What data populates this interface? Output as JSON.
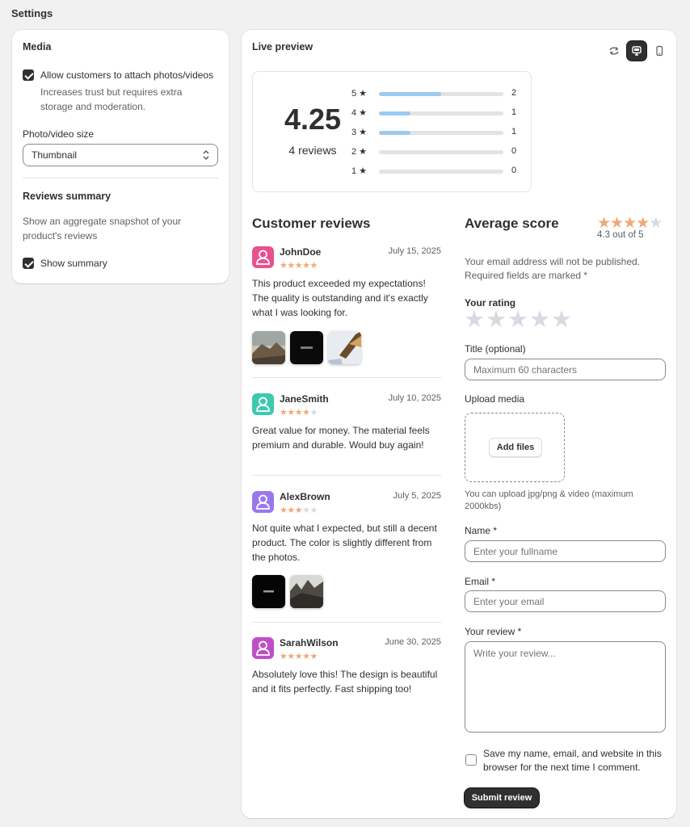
{
  "page": {
    "title": "Settings"
  },
  "settings": {
    "media": {
      "title": "Media",
      "allow_label": "Allow customers to attach photos/videos",
      "allow_checked": true,
      "allow_help_1": "Increases trust but requires extra",
      "allow_help_2": "storage and moderation.",
      "size_label": "Photo/video size",
      "size_value": "Thumbnail"
    },
    "summary": {
      "title": "Reviews summary",
      "desc_1": "Show an aggregate snapshot of your",
      "desc_2": "product's reviews",
      "show_label": "Show summary",
      "show_checked": true
    }
  },
  "preview": {
    "title": "Live preview",
    "tools": [
      "refresh-icon",
      "desktop-icon",
      "mobile-icon"
    ],
    "active_tool": "desktop-icon",
    "summary": {
      "average": "4.25",
      "count_text": "4 reviews",
      "distribution": [
        {
          "label": "5 ★",
          "count": "2",
          "fraction": 0.5
        },
        {
          "label": "4 ★",
          "count": "1",
          "fraction": 0.25
        },
        {
          "label": "3 ★",
          "count": "1",
          "fraction": 0.25
        },
        {
          "label": "2 ★",
          "count": "0",
          "fraction": 0
        },
        {
          "label": "1 ★",
          "count": "0",
          "fraction": 0
        }
      ]
    },
    "reviews_heading": "Customer reviews",
    "reviews": [
      {
        "author": "JohnDoe",
        "date": "July 15, 2025",
        "rating": 5,
        "avatar_color": "#e8508e",
        "lines": [
          "This product exceeded my expectations!",
          "The quality is outstanding and it's exactly",
          "what I was looking for."
        ]
      },
      {
        "author": "JaneSmith",
        "date": "July 10, 2025",
        "rating": 4,
        "avatar_color": "#3cc9b0",
        "lines": [
          "Great value for money. The material feels",
          "premium and durable. Would buy again!"
        ]
      },
      {
        "author": "AlexBrown",
        "date": "July 5, 2025",
        "rating": 3,
        "avatar_color": "#9a77f0",
        "lines": [
          "Not quite what I expected, but still a decent",
          "product. The color is slightly different from",
          "the photos."
        ]
      },
      {
        "author": "SarahWilson",
        "date": "June 30, 2025",
        "rating": 5,
        "avatar_color": "#c04ec8",
        "lines": [
          "Absolutely love this! The design is beautiful",
          "and it fits perfectly. Fast shipping too!"
        ]
      }
    ],
    "form": {
      "heading": "Average score",
      "score_text": "4.3 out of 5",
      "score_stars": 4,
      "notice_1": "Your email address will not be published.",
      "notice_2": "Required fields are marked *",
      "rating_label": "Your rating",
      "title_label": "Title (optional)",
      "title_placeholder": "Maximum 60 characters",
      "upload_label": "Upload media",
      "add_files": "Add files",
      "upload_help_1": "You can upload jpg/png & video (maximum",
      "upload_help_2": "2000kbs)",
      "name_label": "Name *",
      "name_placeholder": "Enter your fullname",
      "email_label": "Email *",
      "email_placeholder": "Enter your email",
      "review_label": "Your review *",
      "review_placeholder": "Write your review...",
      "save_label_1": "Save my name, email, and website in this",
      "save_label_2": "browser for the next time I comment.",
      "save_checked": false,
      "submit": "Submit review"
    }
  }
}
